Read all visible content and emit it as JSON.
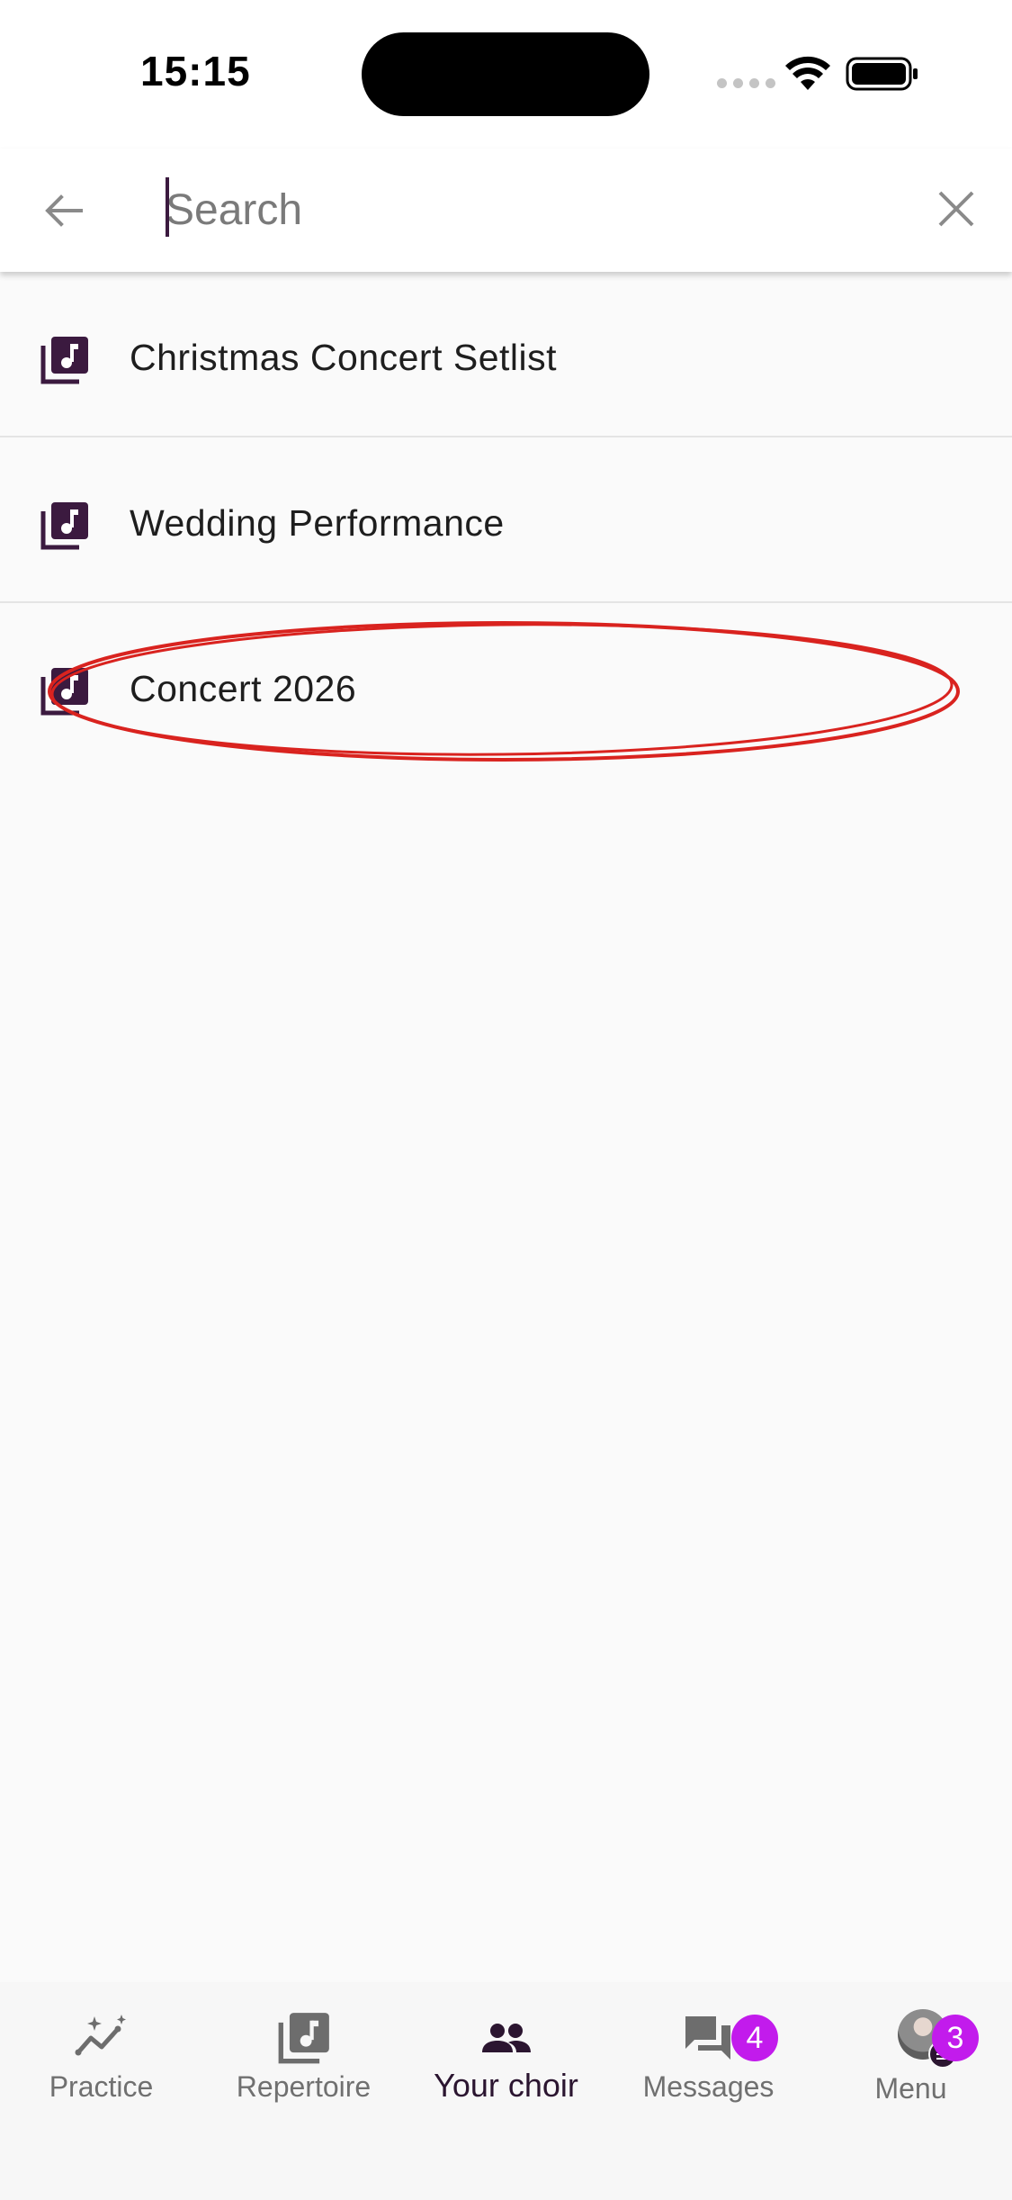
{
  "status_bar": {
    "time": "15:15"
  },
  "search": {
    "placeholder": "Search",
    "value": ""
  },
  "results": [
    {
      "label": "Christmas Concert Setlist",
      "icon": "music-library-icon"
    },
    {
      "label": "Wedding Performance",
      "icon": "music-library-icon"
    },
    {
      "label": "Concert 2026",
      "icon": "music-library-icon",
      "highlighted": true
    }
  ],
  "bottom_nav": {
    "items": [
      {
        "label": "Practice",
        "icon": "practice-chart-icon"
      },
      {
        "label": "Repertoire",
        "icon": "music-library-icon"
      },
      {
        "label": "Your choir",
        "icon": "people-icon",
        "active": true
      },
      {
        "label": "Messages",
        "icon": "chat-icon",
        "badge": "4"
      },
      {
        "label": "Menu",
        "icon": "avatar",
        "badge": "3"
      }
    ]
  },
  "colors": {
    "accent": "#3b1a3f",
    "badge": "#c21bec",
    "highlight": "#d9231f",
    "inactive": "#707070"
  }
}
